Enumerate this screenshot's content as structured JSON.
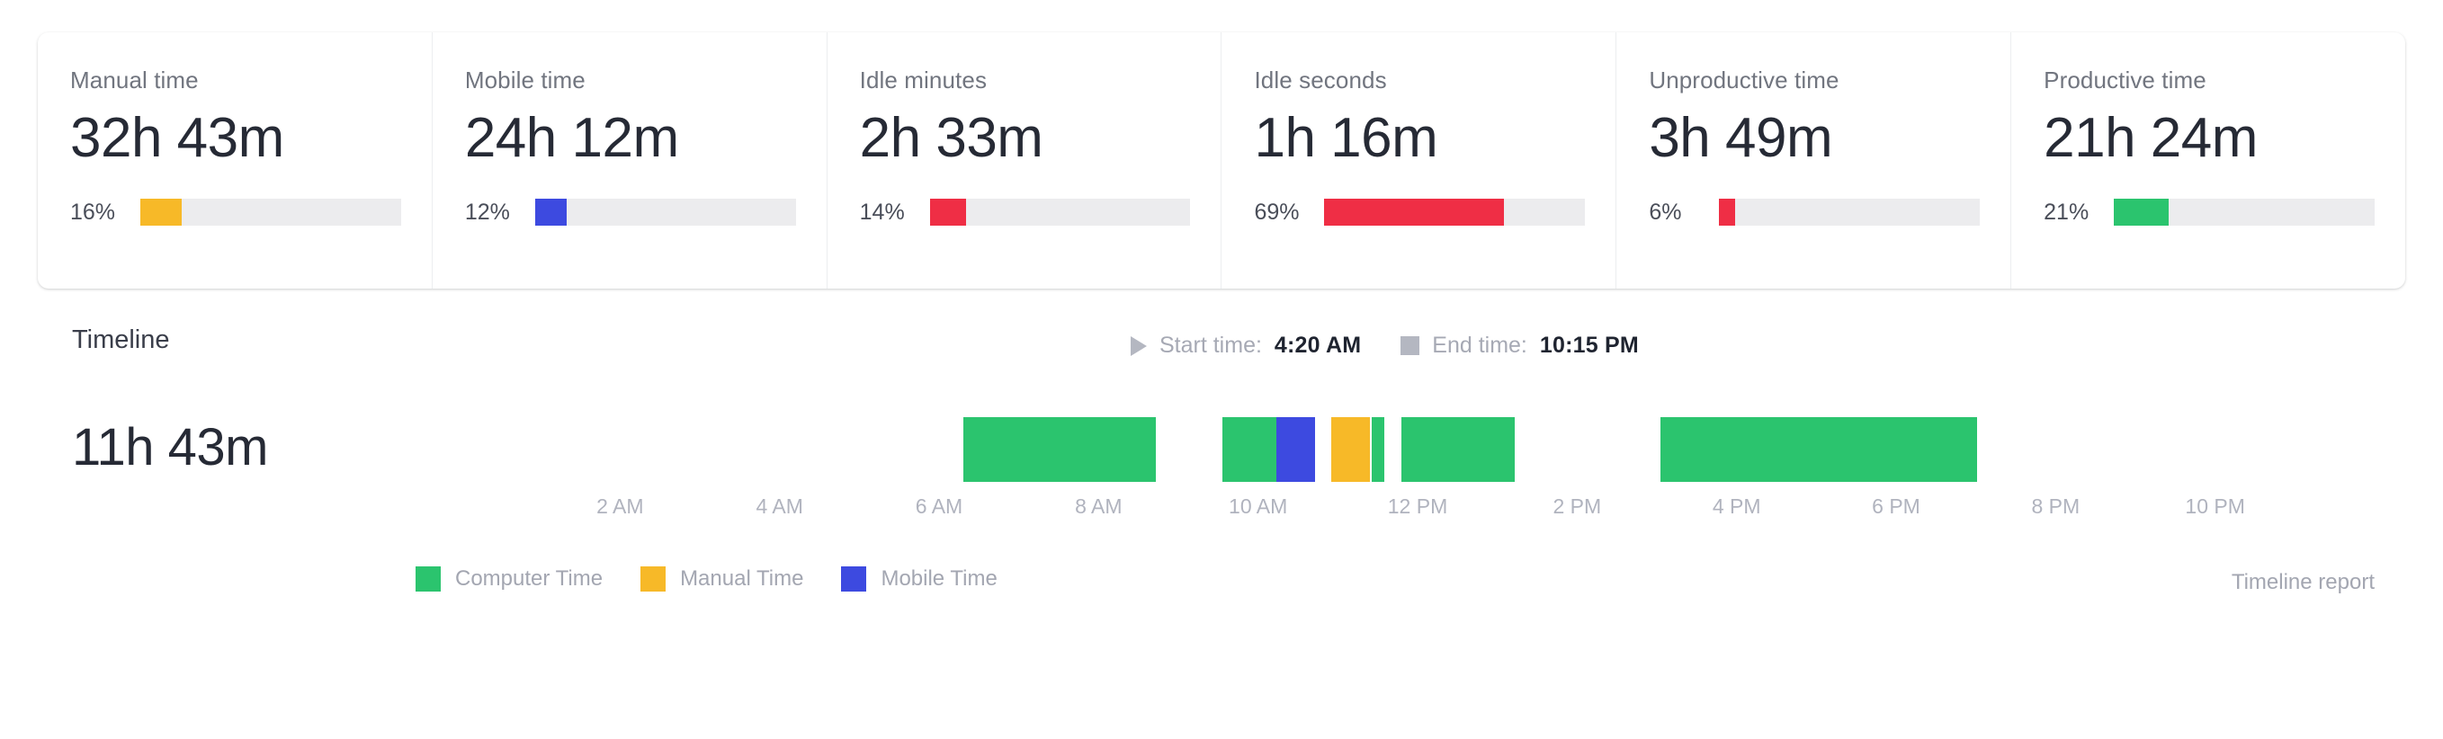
{
  "colors": {
    "manual": "#F7B928",
    "mobile": "#3D4AE0",
    "idle": "#EF2E45",
    "unproductive": "#EF2E45",
    "productive": "#2BC46E",
    "computer": "#2BC46E",
    "track": "#ECECEE",
    "text_dark": "#262A35",
    "text_muted": "#71757F",
    "axis_muted": "#B0B3BE"
  },
  "kpi_cards": [
    {
      "label": "Manual time",
      "value": "32h 43m",
      "percent_label": "16%",
      "percent": 16,
      "color_key": "manual"
    },
    {
      "label": "Mobile time",
      "value": "24h 12m",
      "percent_label": "12%",
      "percent": 12,
      "color_key": "mobile"
    },
    {
      "label": "Idle minutes",
      "value": "2h 33m",
      "percent_label": "14%",
      "percent": 14,
      "color_key": "idle"
    },
    {
      "label": "Idle seconds",
      "value": "1h 16m",
      "percent_label": "69%",
      "percent": 69,
      "color_key": "idle"
    },
    {
      "label": "Unproductive time",
      "value": "3h 49m",
      "percent_label": "6%",
      "percent": 6,
      "color_key": "unproductive"
    },
    {
      "label": "Productive time",
      "value": "21h 24m",
      "percent_label": "21%",
      "percent": 21,
      "color_key": "productive"
    }
  ],
  "timeline": {
    "title": "Timeline",
    "total": "11h 43m",
    "start": {
      "icon": "play-icon",
      "label": "Start time:",
      "value": "4:20 AM"
    },
    "end": {
      "icon": "stop-icon",
      "label": "End time:",
      "value": "10:15 PM"
    },
    "report_link": "Timeline report",
    "legend": [
      {
        "label": "Computer Time",
        "color_key": "computer"
      },
      {
        "label": "Manual Time",
        "color_key": "manual"
      },
      {
        "label": "Mobile Time",
        "color_key": "mobile"
      }
    ]
  },
  "chart_data": {
    "type": "bar",
    "title": "Timeline",
    "xlabel": "",
    "ylabel": "",
    "orientation": "horizontal-gantt",
    "xlim": [
      0,
      24
    ],
    "x_unit": "hour of day",
    "grid": false,
    "legend_position": "bottom-left",
    "tick_labels": [
      "2 AM",
      "4 AM",
      "6 AM",
      "8 AM",
      "10 AM",
      "12 PM",
      "2 PM",
      "4 PM",
      "6 PM",
      "8 PM",
      "10 PM"
    ],
    "tick_values": [
      2,
      4,
      6,
      8,
      10,
      12,
      14,
      16,
      18,
      20,
      22
    ],
    "total_tracked": "11h 43m",
    "start_time": "4:20 AM",
    "end_time": "10:15 PM",
    "series": [
      {
        "name": "Computer Time",
        "color_key": "computer"
      },
      {
        "name": "Manual Time",
        "color_key": "manual"
      },
      {
        "name": "Mobile Time",
        "color_key": "mobile"
      }
    ],
    "segments": [
      {
        "series": "Computer Time",
        "start": 6.3,
        "end": 8.72,
        "color_key": "computer"
      },
      {
        "series": "Computer Time",
        "start": 9.55,
        "end": 10.23,
        "color_key": "computer"
      },
      {
        "series": "Mobile Time",
        "start": 10.23,
        "end": 10.72,
        "color_key": "mobile"
      },
      {
        "series": "Manual Time",
        "start": 10.92,
        "end": 11.4,
        "color_key": "manual"
      },
      {
        "series": "Computer Time",
        "start": 11.42,
        "end": 11.58,
        "color_key": "computer"
      },
      {
        "series": "Computer Time",
        "start": 11.8,
        "end": 13.22,
        "color_key": "computer"
      },
      {
        "series": "Computer Time",
        "start": 15.05,
        "end": 19.02,
        "color_key": "computer"
      }
    ]
  }
}
